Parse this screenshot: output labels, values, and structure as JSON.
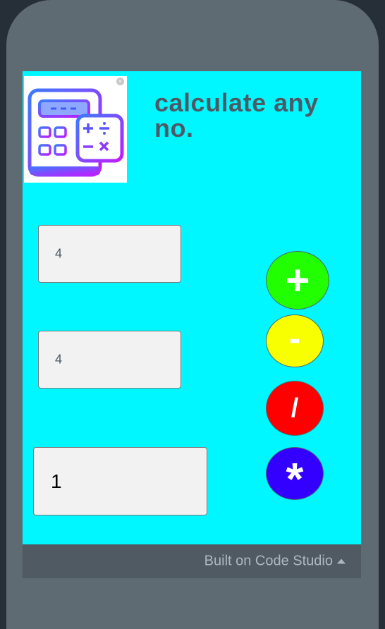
{
  "app": {
    "title": "calculate any no."
  },
  "inputs": {
    "first_value": "4",
    "second_value": "4",
    "result_value": "1"
  },
  "operators": {
    "add": "+",
    "subtract": "-",
    "divide": "/",
    "multiply": "*"
  },
  "colors": {
    "screen_bg": "#00f7ff",
    "add_button": "#22ff00",
    "subtract_button": "#f7ff00",
    "divide_button": "#ff0000",
    "multiply_button": "#3300ff"
  },
  "icons": {
    "logo": "calculator-icon",
    "ad_close": "close-icon",
    "footer_caret": "caret-up-icon"
  },
  "footer": {
    "label": "Built on Code Studio"
  }
}
